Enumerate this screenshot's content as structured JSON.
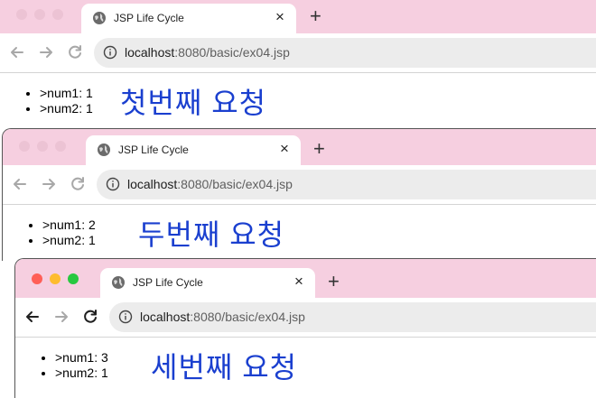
{
  "windows": [
    {
      "tab": {
        "title": "JSP Life Cycle",
        "close": "×"
      },
      "new_tab": "+",
      "url": {
        "host": "localhost",
        "rest": ":8080/basic/ex04.jsp"
      },
      "items": [
        ">num1: 1",
        ">num2: 1"
      ],
      "note": "첫번째 요청",
      "active": false
    },
    {
      "tab": {
        "title": "JSP Life Cycle",
        "close": "×"
      },
      "new_tab": "+",
      "url": {
        "host": "localhost",
        "rest": ":8080/basic/ex04.jsp"
      },
      "items": [
        ">num1: 2",
        ">num2: 1"
      ],
      "note": "두번째 요청",
      "active": false
    },
    {
      "tab": {
        "title": "JSP Life Cycle",
        "close": "×"
      },
      "new_tab": "+",
      "url": {
        "host": "localhost",
        "rest": ":8080/basic/ex04.jsp"
      },
      "items": [
        ">num1: 3",
        ">num2: 1"
      ],
      "note": "세번째 요청",
      "active": true
    }
  ],
  "icons": {
    "favicon": "globe-icon",
    "info": "info-icon",
    "back": "back-arrow-icon",
    "forward": "forward-arrow-icon",
    "reload": "reload-icon"
  },
  "colors": {
    "tabstrip": "#f6cfe0",
    "annotation": "#1a3fcf",
    "omnibox": "#ececec"
  }
}
